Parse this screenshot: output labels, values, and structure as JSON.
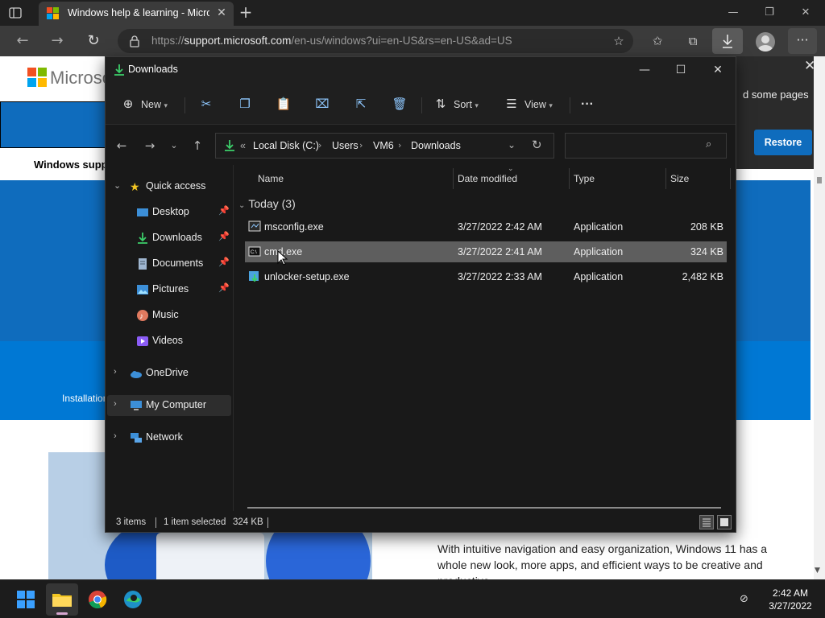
{
  "browser": {
    "tab_title": "Windows help & learning - Microsoft Support",
    "url_host": "support.microsoft.com",
    "url_prefix": "https://",
    "url_path": "/en-us/windows?ui=en-US&rs=en-US&ad=US"
  },
  "webpage": {
    "logo_word": "Microsoft",
    "support_heading": "Windows support",
    "install_label": "Installation",
    "notification_text": "d some pages",
    "restore_label": "Restore",
    "body_text": "With intuitive navigation and easy organization, Windows 11 has a whole new look, more apps, and efficient ways to be creative and productive."
  },
  "explorer": {
    "title": "Downloads",
    "toolbar": {
      "new_label": "New",
      "sort_label": "Sort",
      "view_label": "View",
      "more_label": "···"
    },
    "breadcrumb": {
      "overflow": "«",
      "parts": [
        "Local Disk (C:)",
        "Users",
        "VM6",
        "Downloads"
      ]
    },
    "search": {
      "placeholder": ""
    },
    "sidebar": {
      "quick_access": "Quick access",
      "items": [
        {
          "label": "Desktop",
          "icon": "desktop-icon"
        },
        {
          "label": "Downloads",
          "icon": "download-icon"
        },
        {
          "label": "Documents",
          "icon": "document-icon"
        },
        {
          "label": "Pictures",
          "icon": "pictures-icon"
        },
        {
          "label": "Music",
          "icon": "music-icon"
        },
        {
          "label": "Videos",
          "icon": "video-icon"
        }
      ],
      "onedrive": "OneDrive",
      "my_computer": "My Computer",
      "network": "Network"
    },
    "columns": {
      "name": "Name",
      "date": "Date modified",
      "type": "Type",
      "size": "Size"
    },
    "group_label": "Today (3)",
    "files": [
      {
        "name": "msconfig.exe",
        "date": "3/27/2022 2:42 AM",
        "type": "Application",
        "size": "208 KB"
      },
      {
        "name": "cmd.exe",
        "date": "3/27/2022 2:41 AM",
        "type": "Application",
        "size": "324 KB"
      },
      {
        "name": "unlocker-setup.exe",
        "date": "3/27/2022 2:33 AM",
        "type": "Application",
        "size": "2,482 KB"
      }
    ],
    "status": {
      "items": "3 items",
      "selected": "1 item selected",
      "size": "324 KB"
    }
  },
  "taskbar": {
    "time": "2:42 AM",
    "date": "3/27/2022"
  },
  "colors": {
    "accent": "#0f6cbd",
    "selection": "#5e5e5e",
    "explorer_bg": "#191919"
  }
}
